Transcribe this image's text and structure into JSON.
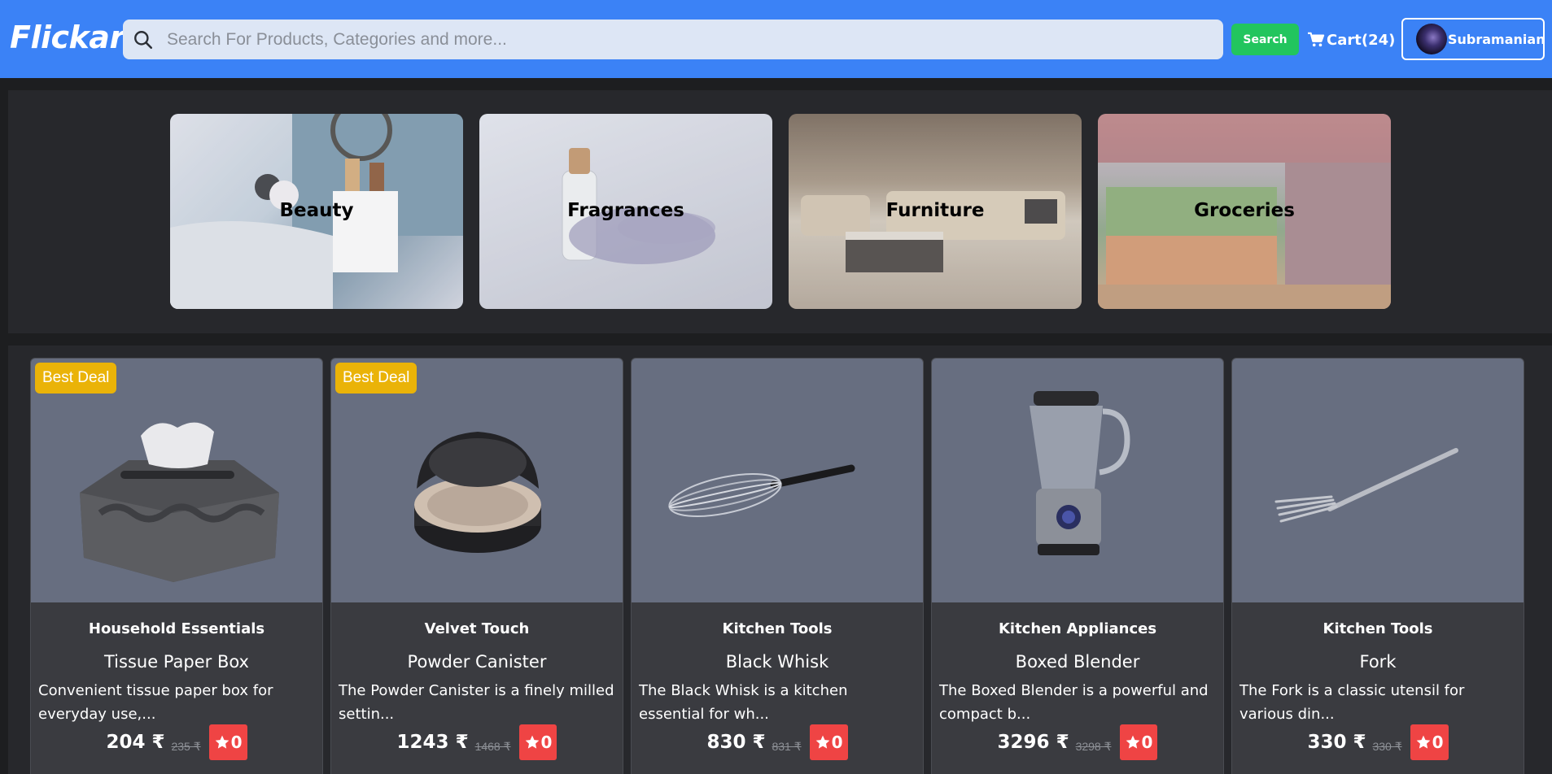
{
  "navbar": {
    "brand": "Flickart",
    "search_placeholder": "Search For Products, Categories and more...",
    "search_button": "Search",
    "cart_label": "Cart(24)",
    "user_name": "Subramanian",
    "bg_color": "#3b82f6"
  },
  "categories": [
    {
      "label": "Beauty"
    },
    {
      "label": "Fragrances"
    },
    {
      "label": "Furniture"
    },
    {
      "label": "Groceries"
    }
  ],
  "products": [
    {
      "badge": "Best Deal",
      "brand": "Household Essentials",
      "title": "Tissue Paper Box",
      "description": "Convenient tissue paper box for everyday use,...",
      "price": "204 ₹",
      "old_price": "235 ₹",
      "rating": "0",
      "image": "tissue-box"
    },
    {
      "badge": "Best Deal",
      "brand": "Velvet Touch",
      "title": "Powder Canister",
      "description": "The Powder Canister is a finely milled settin...",
      "price": "1243 ₹",
      "old_price": "1468 ₹",
      "rating": "0",
      "image": "powder-canister"
    },
    {
      "badge": "",
      "brand": "Kitchen Tools",
      "title": "Black Whisk",
      "description": "The Black Whisk is a kitchen essential for wh...",
      "price": "830 ₹",
      "old_price": "831 ₹",
      "rating": "0",
      "image": "whisk"
    },
    {
      "badge": "",
      "brand": "Kitchen Appliances",
      "title": "Boxed Blender",
      "description": "The Boxed Blender is a powerful and compact b...",
      "price": "3296 ₹",
      "old_price": "3298 ₹",
      "rating": "0",
      "image": "blender"
    },
    {
      "badge": "",
      "brand": "Kitchen Tools",
      "title": "Fork",
      "description": "The Fork is a classic utensil for various din...",
      "price": "330 ₹",
      "old_price": "330 ₹",
      "rating": "0",
      "image": "fork"
    }
  ],
  "colors": {
    "badge": "#eab308",
    "search_button": "#22c55e",
    "rating": "#ef4444",
    "card": "#3a3b40",
    "page": "#1d1e20"
  }
}
